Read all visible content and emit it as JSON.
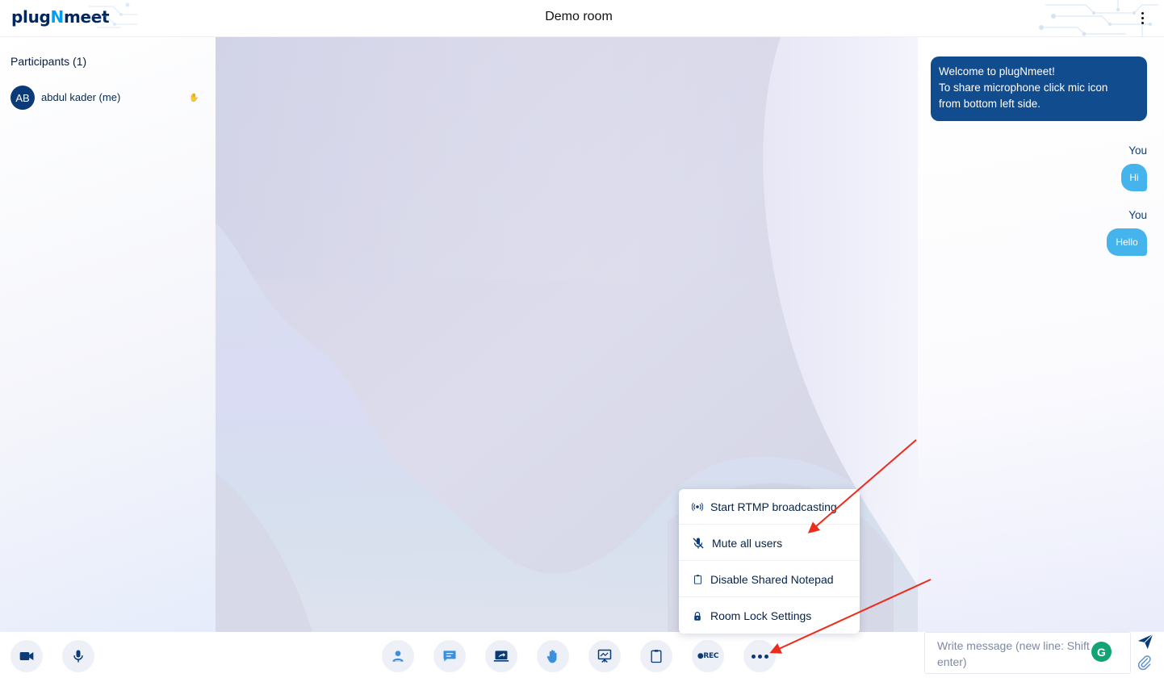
{
  "header": {
    "logo_prefix": "plug",
    "logo_n": "N",
    "logo_suffix": "meet",
    "room_title": "Demo room"
  },
  "participants": {
    "title": "Participants (1)",
    "list": [
      {
        "initials": "AB",
        "name": "abdul kader (me)",
        "hand_raised": true
      }
    ]
  },
  "chat": {
    "welcome": [
      "Welcome to plugNmeet!",
      "To share microphone click mic icon",
      "from bottom left side."
    ],
    "messages": [
      {
        "author": "You",
        "text": "Hi"
      },
      {
        "author": "You",
        "text": "Hello"
      }
    ],
    "input_placeholder": "Write message (new line: Shift + enter)",
    "grammarly_badge": "G"
  },
  "toolbar": {
    "left": [
      "camera-icon",
      "microphone-icon"
    ],
    "center": [
      "participants-icon",
      "chat-icon",
      "share-screen-icon",
      "raise-hand-icon",
      "whiteboard-icon",
      "notepad-icon",
      "recording-icon",
      "more-options-icon"
    ],
    "rec_label": "●REC"
  },
  "more_menu": {
    "items": [
      {
        "label": "Start RTMP broadcasting",
        "icon": "broadcast-icon"
      },
      {
        "label": "Mute all users",
        "icon": "mic-off-icon"
      },
      {
        "label": "Disable Shared Notepad",
        "icon": "clipboard-icon"
      },
      {
        "label": "Room Lock Settings",
        "icon": "lock-icon"
      }
    ]
  },
  "colors": {
    "brand_navy": "#00275e",
    "brand_blue": "#00a0f0",
    "welcome_bg": "#114c8f",
    "bubble": "#45b3ec",
    "annotation_arrow": "#ee2b1a"
  }
}
